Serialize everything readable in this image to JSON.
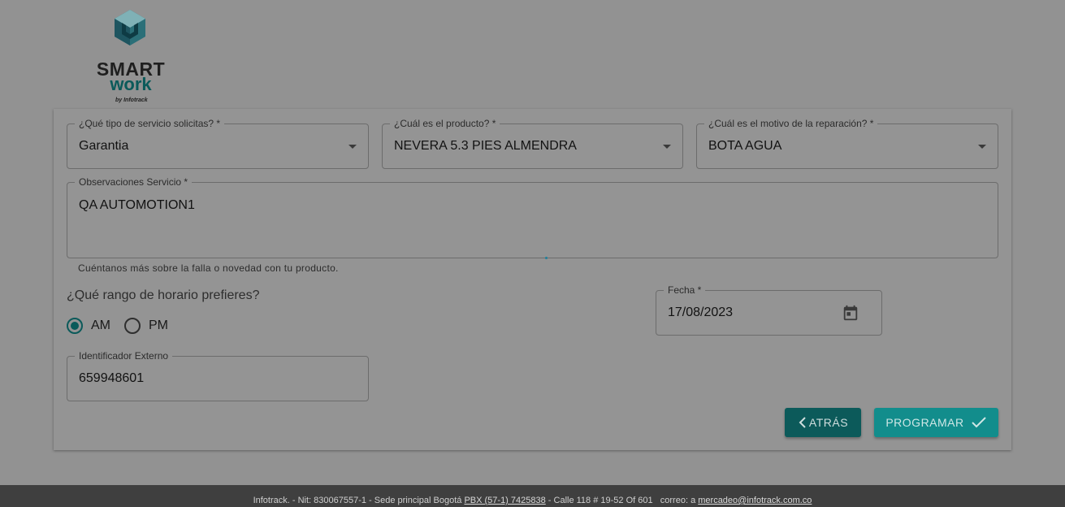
{
  "brand": {
    "line1": "SMART",
    "line2": "work",
    "line3": "by Infotrack"
  },
  "form": {
    "service_type": {
      "label": "¿Qué tipo de servicio solicitas? *",
      "value": "Garantia"
    },
    "product": {
      "label": "¿Cuál es el producto? *",
      "value": "NEVERA 5.3 PIES ALMENDRA"
    },
    "reason": {
      "label": "¿Cuál es el motivo de la reparación? *",
      "value": "BOTA AGUA"
    },
    "observations": {
      "label": "Observaciones Servicio *",
      "value": "QA AUTOMOTION1",
      "helper": "Cuéntanos más sobre la falla o novedad con tu producto."
    },
    "schedule": {
      "question": "¿Qué rango de horario prefieres?",
      "options": [
        "AM",
        "PM"
      ],
      "selected": "AM"
    },
    "date": {
      "label": "Fecha *",
      "value": "17/08/2023"
    },
    "external_id": {
      "label": "Identificador Externo",
      "value": "659948601"
    },
    "buttons": {
      "back": "ATRÁS",
      "schedule": "PROGRAMAR"
    }
  },
  "footer": {
    "part1": "Infotrack. - Nit: 830067557-1 - Sede principal Bogotá ",
    "phone": "PBX (57-1) 7425838",
    "part2": " - Calle 118 # 19-52 Of 601   correo: a ",
    "email": "mercadeo@infotrack.com.co"
  },
  "colors": {
    "primary_dark": "#0c5a5a",
    "primary": "#128d8c",
    "overlay_bg": "#929292",
    "footer_bg": "#3f3f3f"
  },
  "icons": [
    "smartwork-logo-icon",
    "caret-down-icon",
    "calendar-icon",
    "chevron-left-icon",
    "check-icon"
  ]
}
